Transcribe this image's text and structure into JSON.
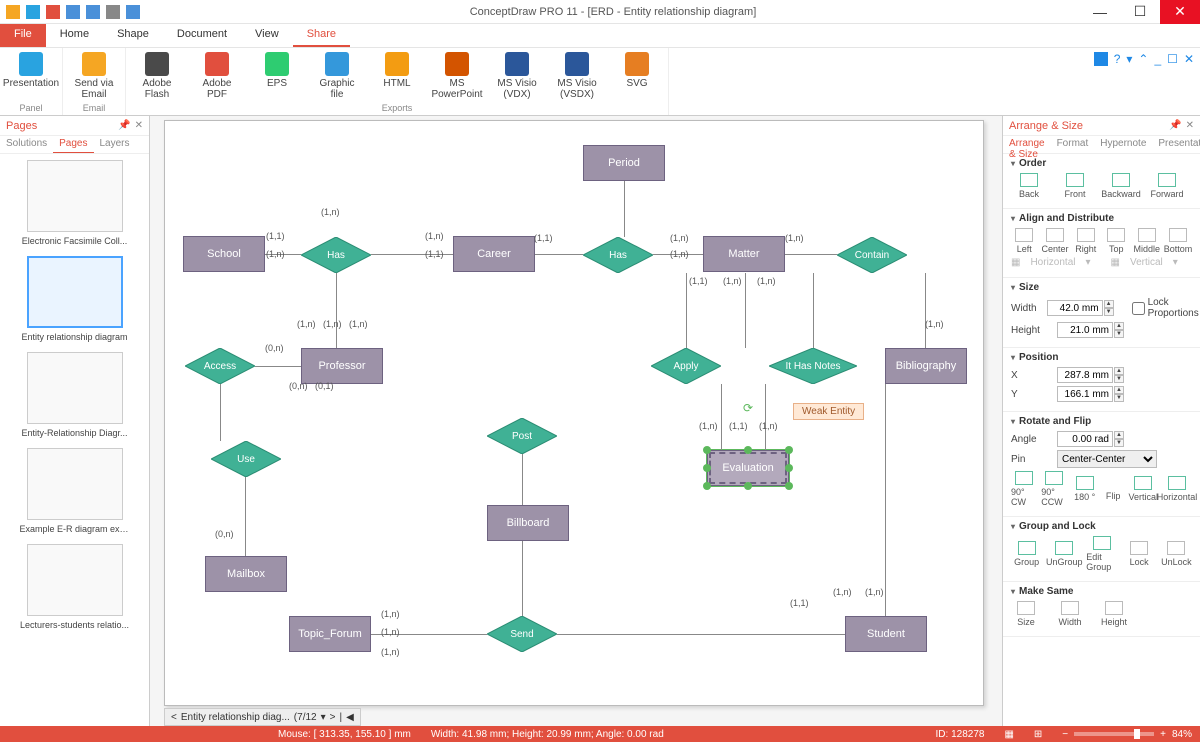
{
  "app": {
    "title": "ConceptDraw PRO 11 - [ERD - Entity relationship diagram]"
  },
  "ribbon": {
    "tabs": [
      "File",
      "Home",
      "Shape",
      "Document",
      "View",
      "Share"
    ],
    "active_tab": "Share",
    "groups": {
      "panel": {
        "label": "Panel",
        "items": [
          "Presentation"
        ]
      },
      "email": {
        "label": "Email",
        "items": [
          "Send via Email"
        ]
      },
      "exports": {
        "label": "Exports",
        "items": [
          "Adobe Flash",
          "Adobe PDF",
          "EPS",
          "Graphic file",
          "HTML",
          "MS PowerPoint",
          "MS Visio (VDX)",
          "MS Visio (VSDX)",
          "SVG"
        ]
      }
    }
  },
  "pages_panel": {
    "title": "Pages",
    "subtabs": [
      "Solutions",
      "Pages",
      "Layers"
    ],
    "active_subtab": "Pages",
    "thumbs": [
      "Electronic Facsimile Coll...",
      "Entity relationship diagram",
      "Entity-Relationship Diagr...",
      "Example E-R diagram ext...",
      "Lecturers-students relatio..."
    ],
    "selected_index": 1
  },
  "right_panel": {
    "title": "Arrange & Size",
    "subtabs": [
      "Arrange & Size",
      "Format",
      "Hypernote",
      "Presentation"
    ],
    "order_items": [
      "Back",
      "Front",
      "Backward",
      "Forward"
    ],
    "align_row1": [
      "Left",
      "Center",
      "Right",
      "Top",
      "Middle",
      "Bottom"
    ],
    "align_row2": [
      "Horizontal",
      "Vertical"
    ],
    "size": {
      "width": "42.0 mm",
      "height": "21.0 mm",
      "lock_label": "Lock Proportions"
    },
    "position": {
      "x": "287.8 mm",
      "y": "166.1 mm"
    },
    "rotate": {
      "angle": "0.00 rad",
      "pin": "Center-Center",
      "items": [
        "90° CW",
        "90° CCW",
        "180 °",
        "Flip",
        "Vertical",
        "Horizontal"
      ]
    },
    "group_items": [
      "Group",
      "UnGroup",
      "Edit Group",
      "Lock",
      "UnLock"
    ],
    "make_same": [
      "Size",
      "Width",
      "Height"
    ],
    "sections": {
      "order": "Order",
      "align": "Align and Distribute",
      "size": "Size",
      "position": "Position",
      "rotate": "Rotate and Flip",
      "group": "Group and Lock",
      "make_same": "Make Same"
    }
  },
  "diagram": {
    "entities": {
      "period": "Period",
      "school": "School",
      "career": "Career",
      "matter": "Matter",
      "bibliography": "Bibliography",
      "professor": "Professor",
      "billboard": "Billboard",
      "mailbox": "Mailbox",
      "topic_forum": "Topic_Forum",
      "student": "Student",
      "evaluation": "Evaluation"
    },
    "relationships": {
      "has1": "Has",
      "has2": "Has",
      "contain": "Contain",
      "access": "Access",
      "apply": "Apply",
      "it_has_notes": "It Has Notes",
      "use": "Use",
      "post": "Post",
      "send": "Send"
    },
    "tooltip": "Weak Entity",
    "cards": {
      "c11": "(1,1)",
      "c1n": "(1,n)",
      "c0n": "(0,n)",
      "c01": "(0,1)"
    }
  },
  "canvas_tabs": {
    "name": "Entity relationship diag...",
    "counter": "(7/12"
  },
  "status": {
    "mouse": "Mouse: [ 313.35, 155.10 ] mm",
    "dims": "Width: 41.98 mm;  Height: 20.99 mm;  Angle: 0.00 rad",
    "id": "ID: 128278",
    "zoom": "84%"
  }
}
